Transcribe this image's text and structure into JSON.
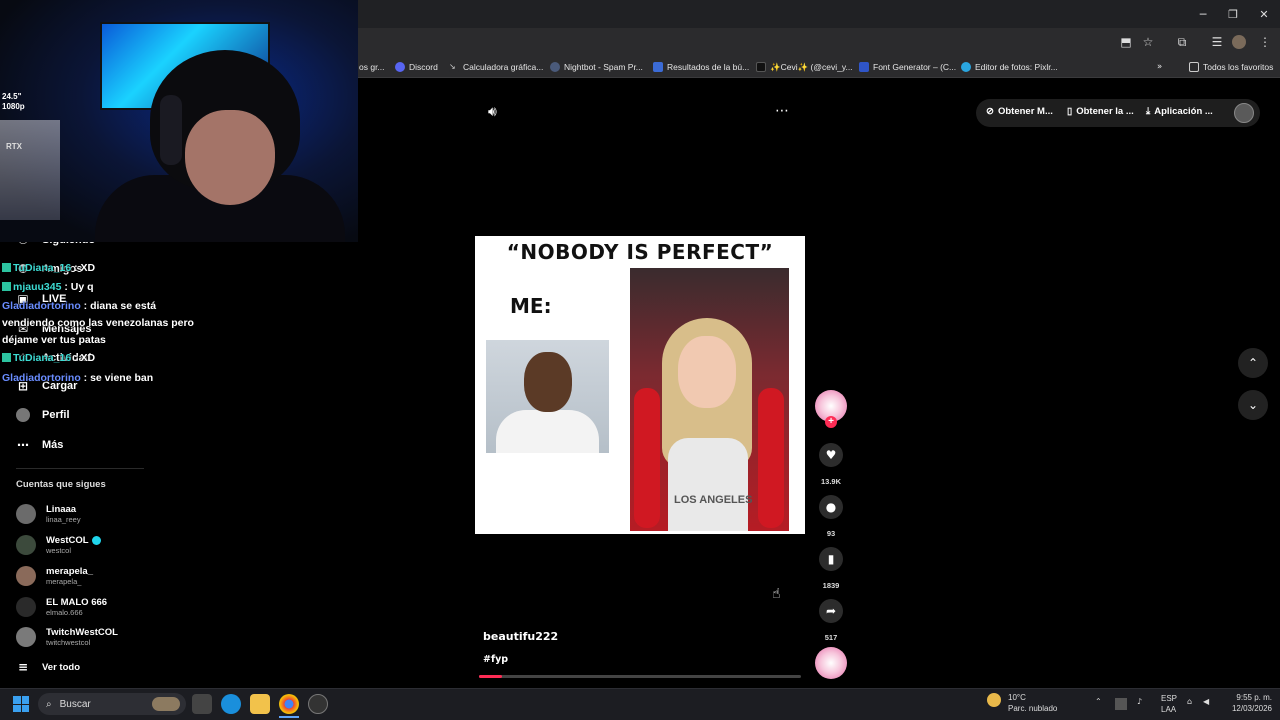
{
  "browser": {
    "bookmarks": [
      {
        "label": "os gr..."
      },
      {
        "label": "Discord"
      },
      {
        "label": "Calculadora gráfica..."
      },
      {
        "label": "Nightbot - Spam Pr..."
      },
      {
        "label": "Resultados de la bú..."
      },
      {
        "label": "✨Cevi✨ (@cevi_y..."
      },
      {
        "label": "Font Generator – (C..."
      },
      {
        "label": "Editor de fotos: Pixlr..."
      }
    ],
    "bookmarks_all": "Todos los favoritos"
  },
  "sidebar": {
    "nav": [
      {
        "label": "Siguiendo",
        "icon": "following-icon"
      },
      {
        "label": "Amigos",
        "icon": "friends-icon"
      },
      {
        "label": "LIVE",
        "icon": "live-icon"
      },
      {
        "label": "Mensajes",
        "icon": "messages-icon"
      },
      {
        "label": "Actividad",
        "icon": "activity-icon"
      },
      {
        "label": "Cargar",
        "icon": "upload-icon"
      },
      {
        "label": "Perfil",
        "icon": "profile-icon"
      },
      {
        "label": "Más",
        "icon": "more-icon"
      }
    ],
    "following_title": "Cuentas que sigues",
    "accounts": [
      {
        "name": "Linaaa",
        "handle": "linaa_reey",
        "verified": false
      },
      {
        "name": "WestCOL",
        "handle": "westcol",
        "verified": true
      },
      {
        "name": "merapela_",
        "handle": "merapela_",
        "verified": false
      },
      {
        "name": "EL MALO 666",
        "handle": "elmalo.666",
        "verified": false
      },
      {
        "name": "TwitchWestCOL",
        "handle": "twitchwestcol",
        "verified": false
      }
    ],
    "see_all": "Ver todo"
  },
  "chat": [
    {
      "user": "TuDiana_16",
      "text": ": XD"
    },
    {
      "user": "mjauu345",
      "text": ": Uy q"
    },
    {
      "user": "Gladiadortorino",
      "text": ": diana se está"
    },
    {
      "user": "",
      "text": "vendiendo como las venezolanas pero"
    },
    {
      "user": "",
      "text": "déjame ver tus patas"
    },
    {
      "user": "TuDiana_16",
      "text": ": XD"
    },
    {
      "user": "Gladiadortorino",
      "text": ": se viene ban"
    }
  ],
  "webcam": {
    "labels": [
      "24.5\"",
      "1080p",
      "RTX"
    ]
  },
  "topbar": {
    "link1": "Obtener M...",
    "link2": "Obtener la ...",
    "link3": "Aplicación ..."
  },
  "video": {
    "meme_title": "“NOBODY IS PERFECT”",
    "meme_me": "ME:",
    "shirt_text": "LOS ANGELES",
    "author": "beautifu222",
    "hashtag": "#fyp",
    "progress": 0.07
  },
  "actions": {
    "likes": "13.9K",
    "comments": "93",
    "saves": "1839",
    "shares": "517"
  },
  "taskbar": {
    "search_placeholder": "Buscar",
    "weather_temp": "10°C",
    "weather_desc": "Parc. nublado",
    "lang1": "ESP",
    "lang2": "LAA",
    "time": "9:55 p. m.",
    "date": "12/03/2026"
  },
  "colors": {
    "accent": "#fe2c55",
    "chat_user_a": "#3ddbd3",
    "chat_user_b": "#6a8dff"
  }
}
